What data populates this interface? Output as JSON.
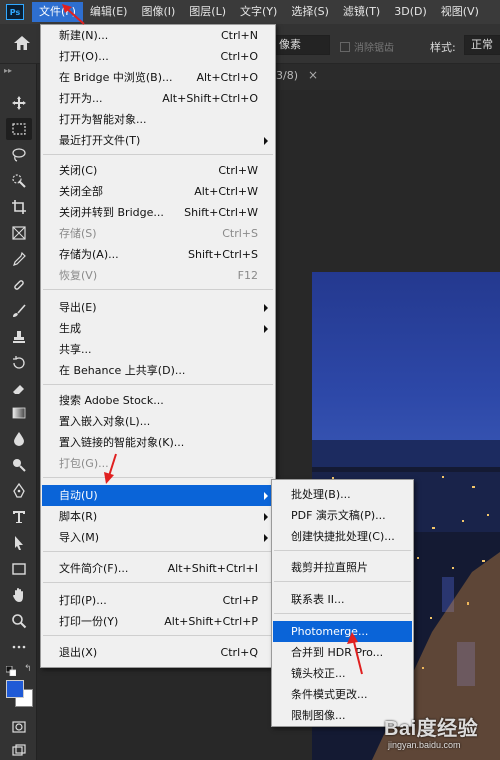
{
  "menubar": {
    "items": [
      "文件(F)",
      "编辑(E)",
      "图像(I)",
      "图层(L)",
      "文字(Y)",
      "选择(S)",
      "滤镜(T)",
      "3D(D)",
      "视图(V)"
    ]
  },
  "options": {
    "unit": "像素",
    "antialias": "消除锯齿",
    "style_label": "样式:",
    "style_value": "正常"
  },
  "doc_tab": {
    "name": "3/8)",
    "close": "×"
  },
  "file_menu": {
    "items": [
      {
        "label": "新建(N)...",
        "shortcut": "Ctrl+N"
      },
      {
        "label": "打开(O)...",
        "shortcut": "Ctrl+O"
      },
      {
        "label": "在 Bridge 中浏览(B)...",
        "shortcut": "Alt+Ctrl+O"
      },
      {
        "label": "打开为...",
        "shortcut": "Alt+Shift+Ctrl+O"
      },
      {
        "label": "打开为智能对象...",
        "shortcut": ""
      },
      {
        "label": "最近打开文件(T)",
        "shortcut": ""
      },
      {
        "label": "关闭(C)",
        "shortcut": "Ctrl+W"
      },
      {
        "label": "关闭全部",
        "shortcut": "Alt+Ctrl+W"
      },
      {
        "label": "关闭并转到 Bridge...",
        "shortcut": "Shift+Ctrl+W"
      },
      {
        "label": "存储(S)",
        "shortcut": "Ctrl+S"
      },
      {
        "label": "存储为(A)...",
        "shortcut": "Shift+Ctrl+S"
      },
      {
        "label": "恢复(V)",
        "shortcut": "F12"
      },
      {
        "label": "导出(E)",
        "shortcut": ""
      },
      {
        "label": "生成",
        "shortcut": ""
      },
      {
        "label": "共享...",
        "shortcut": ""
      },
      {
        "label": "在 Behance 上共享(D)...",
        "shortcut": ""
      },
      {
        "label": "搜索 Adobe Stock...",
        "shortcut": ""
      },
      {
        "label": "置入嵌入对象(L)...",
        "shortcut": ""
      },
      {
        "label": "置入链接的智能对象(K)...",
        "shortcut": ""
      },
      {
        "label": "打包(G)...",
        "shortcut": ""
      },
      {
        "label": "自动(U)",
        "shortcut": ""
      },
      {
        "label": "脚本(R)",
        "shortcut": ""
      },
      {
        "label": "导入(M)",
        "shortcut": ""
      },
      {
        "label": "文件简介(F)...",
        "shortcut": "Alt+Shift+Ctrl+I"
      },
      {
        "label": "打印(P)...",
        "shortcut": "Ctrl+P"
      },
      {
        "label": "打印一份(Y)",
        "shortcut": "Alt+Shift+Ctrl+P"
      },
      {
        "label": "退出(X)",
        "shortcut": "Ctrl+Q"
      }
    ]
  },
  "auto_submenu": {
    "items": [
      "批处理(B)...",
      "PDF 演示文稿(P)...",
      "创建快捷批处理(C)...",
      "裁剪并拉直照片",
      "联系表 II...",
      "Photomerge...",
      "合并到 HDR Pro...",
      "镜头校正...",
      "条件模式更改...",
      "限制图像..."
    ]
  },
  "watermark": {
    "logo": "Bai度经验",
    "url": "jingyan.baidu.com"
  },
  "colors": {
    "accent": "#0a64d8",
    "foreground_swatch": "#1f5ad6",
    "background_swatch": "#ffffff",
    "arrow_annotation": "#e02020"
  }
}
